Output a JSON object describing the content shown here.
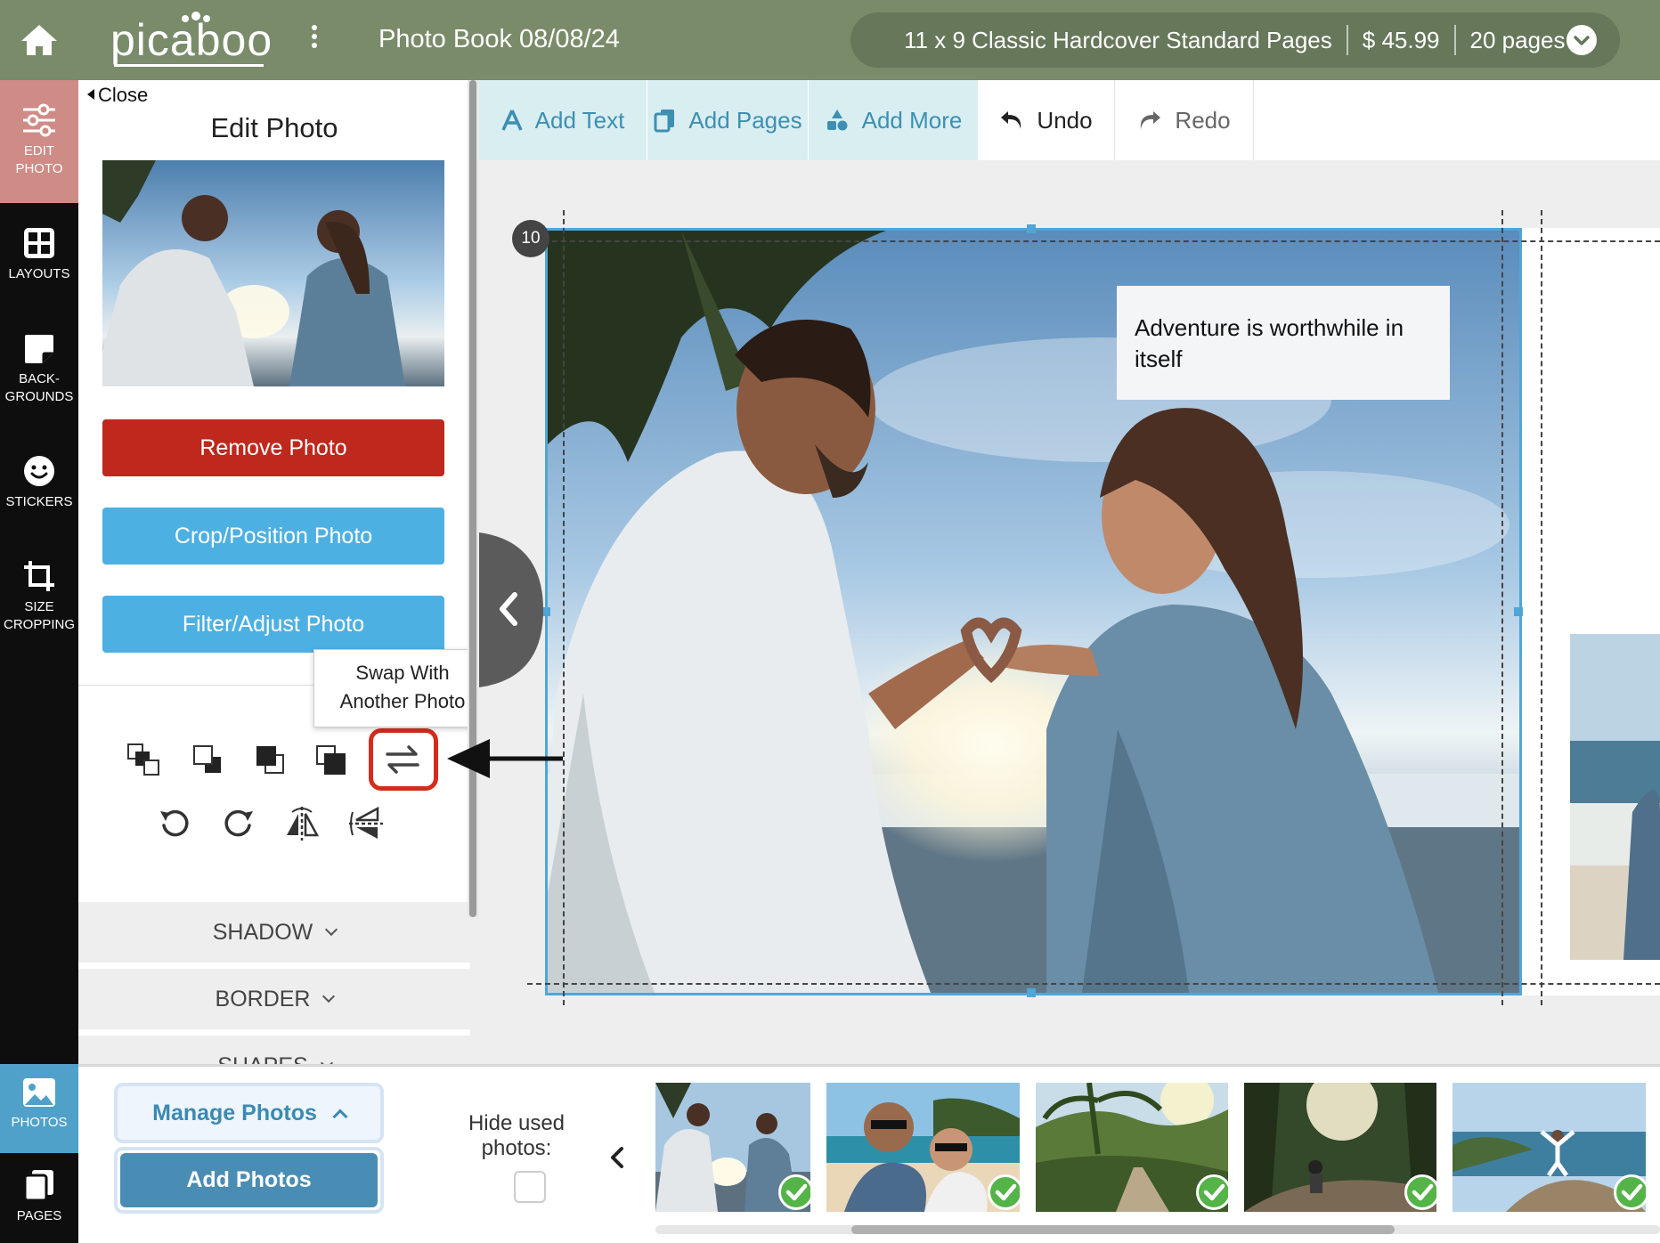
{
  "header": {
    "logo_text": "picaboo",
    "doc_title": "Photo Book 08/08/24",
    "product": "11 x 9 Classic Hardcover Standard Pages",
    "price": "$ 45.99",
    "pages": "20 pages",
    "colors": {
      "bar": "#7a8b6a",
      "pill": "#66775a"
    }
  },
  "sidebar": {
    "items": [
      {
        "label_line1": "EDIT",
        "label_line2": "PHOTO",
        "icon": "sliders-icon",
        "active": true
      },
      {
        "label_line1": "LAYOUTS",
        "icon": "layouts-icon"
      },
      {
        "label_line1": "BACK-",
        "label_line2": "GROUNDS",
        "icon": "background-icon"
      },
      {
        "label_line1": "STICKERS",
        "icon": "smiley-icon"
      },
      {
        "label_line1": "SIZE",
        "label_line2": "CROPPING",
        "icon": "crop-icon"
      },
      {
        "label_line1": "PHOTOS",
        "icon": "photos-icon",
        "active": true
      },
      {
        "label_line1": "PAGES",
        "icon": "pages-icon"
      }
    ]
  },
  "edit_panel": {
    "close_label": "Close",
    "title": "Edit Photo",
    "remove_label": "Remove Photo",
    "crop_label": "Crop/Position Photo",
    "filter_label": "Filter/Adjust Photo",
    "tooltip_line1": "Swap With",
    "tooltip_line2": "Another Photo",
    "shadow_label": "SHADOW",
    "border_label": "BORDER",
    "shapes_label": "SHAPES",
    "tools": [
      "bring-forward-icon",
      "send-backward-icon",
      "bring-to-front-icon",
      "send-to-back-icon",
      "swap-photo-icon",
      "rotate-left-icon",
      "rotate-right-icon",
      "flip-horizontal-icon",
      "flip-vertical-icon"
    ],
    "colors": {
      "remove": "#bf281d",
      "action": "#4db0e2",
      "highlight": "#d42c1b"
    }
  },
  "toolbar": {
    "add_text": "Add Text",
    "add_pages": "Add Pages",
    "add_more": "Add More",
    "undo": "Undo",
    "redo": "Redo"
  },
  "canvas": {
    "page_number": "10",
    "text_box": "Adventure is worthwhile in itself"
  },
  "tray": {
    "manage_label": "Manage Photos",
    "add_photos_label": "Add Photos",
    "hide_used_line1": "Hide used",
    "hide_used_line2": "photos:",
    "thumbnails": [
      {
        "name": "couple-heart-hands",
        "used": true
      },
      {
        "name": "couple-selfie-beach",
        "used": true
      },
      {
        "name": "palm-jungle-road",
        "used": true
      },
      {
        "name": "forest-sunburst-hiker",
        "used": true
      },
      {
        "name": "mountain-coast-jump",
        "used": true
      }
    ]
  }
}
